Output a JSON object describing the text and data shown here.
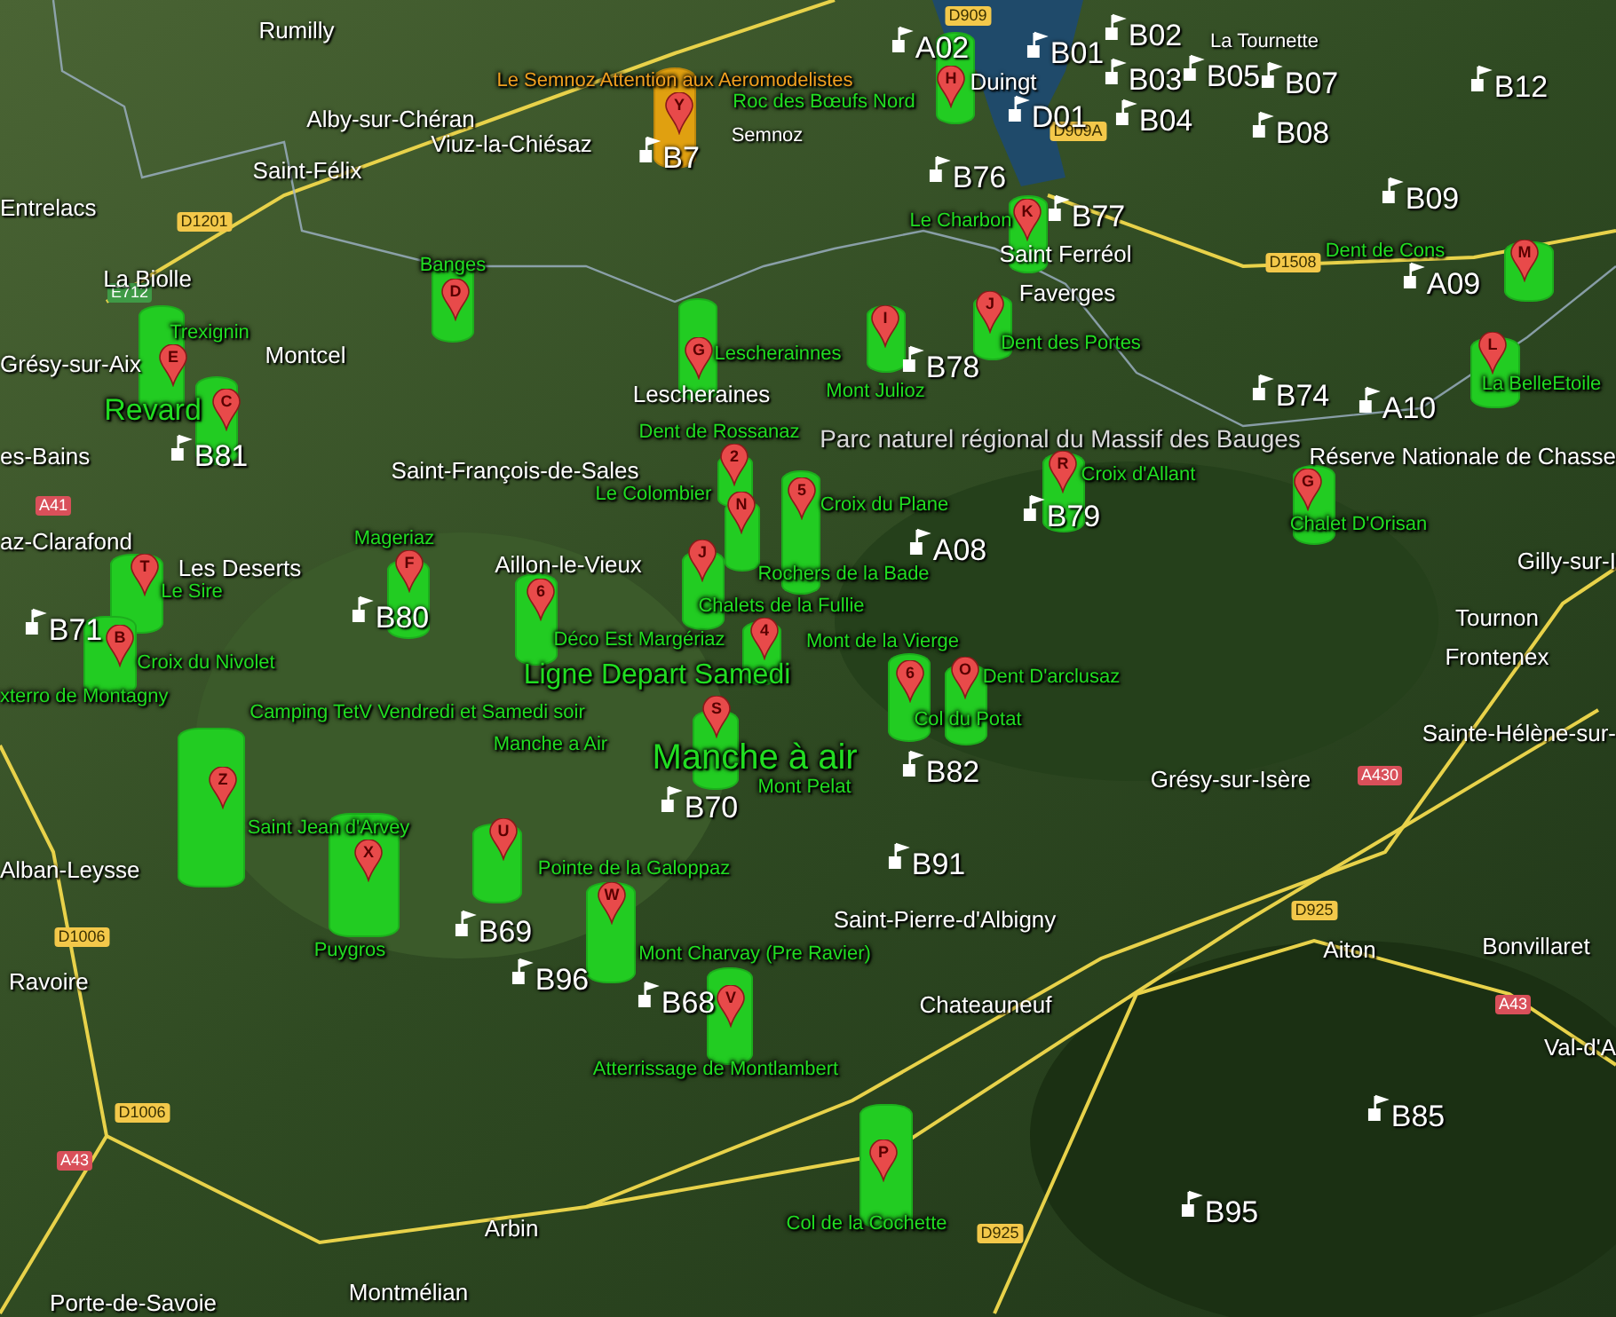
{
  "places": [
    {
      "name": "Rumilly"
    },
    {
      "name": "Alby-sur-Chéran"
    },
    {
      "name": "Viuz-la-Chiésaz"
    },
    {
      "name": "Semnoz"
    },
    {
      "name": "Saint-Félix"
    },
    {
      "name": "Entrelacs"
    },
    {
      "name": "La Biolle"
    },
    {
      "name": "Montcel"
    },
    {
      "name": "Grésy-sur-Aix"
    },
    {
      "name": "Lescheraines"
    },
    {
      "name": "Duingt"
    },
    {
      "name": "La Tournette"
    },
    {
      "name": "Saint Ferréol"
    },
    {
      "name": "Faverges"
    },
    {
      "name": "Parc naturel régional du Massif des Bauges"
    },
    {
      "name": "es-Bains"
    },
    {
      "name": "Saint-François-de-Sales"
    },
    {
      "name": "az-Clarafond"
    },
    {
      "name": "Les Deserts"
    },
    {
      "name": "Aillon-le-Vieux"
    },
    {
      "name": "Réserve Nationale de Chasse"
    },
    {
      "name": "Gilly-sur-I"
    },
    {
      "name": "Tournon"
    },
    {
      "name": "Frontenex"
    },
    {
      "name": "Sainte-Hélène-sur-"
    },
    {
      "name": "Grésy-sur-Isère"
    },
    {
      "name": "Saint-Pierre-d'Albigny"
    },
    {
      "name": "Chateauneuf"
    },
    {
      "name": "Aiton"
    },
    {
      "name": "Bonvillaret"
    },
    {
      "name": "Val-d'A"
    },
    {
      "name": "Alban-Leysse"
    },
    {
      "name": "Ravoire"
    },
    {
      "name": "Arbin"
    },
    {
      "name": "Montmélian"
    },
    {
      "name": "Porte-de-Savoie"
    }
  ],
  "waypoints": [
    {
      "code": "A02"
    },
    {
      "code": "B01"
    },
    {
      "code": "B02"
    },
    {
      "code": "B03"
    },
    {
      "code": "B05"
    },
    {
      "code": "B07"
    },
    {
      "code": "B12"
    },
    {
      "code": "D01"
    },
    {
      "code": "B04"
    },
    {
      "code": "B08"
    },
    {
      "code": "B76"
    },
    {
      "code": "B77"
    },
    {
      "code": "B09"
    },
    {
      "code": "A09"
    },
    {
      "code": "B78"
    },
    {
      "code": "B74"
    },
    {
      "code": "A10"
    },
    {
      "code": "B7"
    },
    {
      "code": "A08"
    },
    {
      "code": "B79"
    },
    {
      "code": "B82"
    },
    {
      "code": "B91"
    },
    {
      "code": "B81"
    },
    {
      "code": "B80"
    },
    {
      "code": "B71"
    },
    {
      "code": "B70"
    },
    {
      "code": "B69"
    },
    {
      "code": "B96"
    },
    {
      "code": "B68"
    },
    {
      "code": "B85"
    },
    {
      "code": "B95"
    }
  ],
  "sites": [
    {
      "name": "Le Semnoz Attention aux Aeromodelistes",
      "color": "#f0a020"
    },
    {
      "name": "Roc des Bœufs Nord",
      "color": "#22dd22"
    },
    {
      "name": "Le Charbon",
      "color": "#22dd22"
    },
    {
      "name": "Dent des Portes",
      "color": "#22dd22"
    },
    {
      "name": "Dent de Cons",
      "color": "#22dd22"
    },
    {
      "name": "La BelleEtoile",
      "color": "#22dd22"
    },
    {
      "name": "Mont Julioz",
      "color": "#22dd22"
    },
    {
      "name": "Banges",
      "color": "#22dd22"
    },
    {
      "name": "Lescherainnes",
      "color": "#22dd22"
    },
    {
      "name": "Trexignin",
      "color": "#22dd22"
    },
    {
      "name": "Revard",
      "color": "#22dd22"
    },
    {
      "name": "Dent de Rossanaz",
      "color": "#22dd22"
    },
    {
      "name": "Le Colombier",
      "color": "#22dd22"
    },
    {
      "name": "Croix du Plane",
      "color": "#22dd22"
    },
    {
      "name": "Rochers de la Bade",
      "color": "#22dd22"
    },
    {
      "name": "Chalets de la Fullie",
      "color": "#22dd22"
    },
    {
      "name": "Mont de la Vierge",
      "color": "#22dd22"
    },
    {
      "name": "Croix d'Allant",
      "color": "#22dd22"
    },
    {
      "name": "Chalet D'Orisan",
      "color": "#22dd22"
    },
    {
      "name": "Dent D'arclusaz",
      "color": "#22dd22"
    },
    {
      "name": "Col du Potat",
      "color": "#22dd22"
    },
    {
      "name": "Mageriaz",
      "color": "#22dd22"
    },
    {
      "name": "Le Sire",
      "color": "#22dd22"
    },
    {
      "name": "Croix du Nivolet",
      "color": "#22dd22"
    },
    {
      "name": "xterro de Montagny",
      "color": "#22dd22"
    },
    {
      "name": "Déco Est Margériaz",
      "color": "#22dd22"
    },
    {
      "name": "Ligne Depart Samedi",
      "color": "#22dd22"
    },
    {
      "name": "Camping TetV Vendredi et Samedi soir",
      "color": "#22dd22"
    },
    {
      "name": "Manche à air",
      "color": "#22dd22"
    },
    {
      "name": "Manche a Air",
      "color": "#22dd22"
    },
    {
      "name": "Mont Pelat",
      "color": "#22dd22"
    },
    {
      "name": "Saint Jean d'Arvey",
      "color": "#22dd22"
    },
    {
      "name": "Pointe de la Galoppaz",
      "color": "#22dd22"
    },
    {
      "name": "Puygros",
      "color": "#22dd22"
    },
    {
      "name": "Mont Charvay (Pre Ravier)",
      "color": "#22dd22"
    },
    {
      "name": "Atterrissage de Montlambert",
      "color": "#22dd22"
    },
    {
      "name": "Col de la Cochette",
      "color": "#22dd22"
    }
  ],
  "road_signs": [
    {
      "label": "D909",
      "kind": "departmental"
    },
    {
      "label": "D909A",
      "kind": "departmental"
    },
    {
      "label": "D1201",
      "kind": "departmental"
    },
    {
      "label": "E712",
      "kind": "european"
    },
    {
      "label": "D1508",
      "kind": "departmental"
    },
    {
      "label": "A41",
      "kind": "autoroute"
    },
    {
      "label": "A430",
      "kind": "autoroute"
    },
    {
      "label": "D925",
      "kind": "departmental"
    },
    {
      "label": "A43",
      "kind": "autoroute"
    },
    {
      "label": "D1006",
      "kind": "departmental"
    },
    {
      "label": "D1006",
      "kind": "departmental"
    },
    {
      "label": "A43",
      "kind": "autoroute"
    },
    {
      "label": "D925",
      "kind": "departmental"
    }
  ],
  "markers": [
    {
      "letter": "Y",
      "color": "#e0a010"
    },
    {
      "letter": "H",
      "color": "#22cc22"
    },
    {
      "letter": "K",
      "color": "#22cc22"
    },
    {
      "letter": "D",
      "color": "#22cc22"
    },
    {
      "letter": "E",
      "color": "#22cc22"
    },
    {
      "letter": "C",
      "color": "#22cc22"
    },
    {
      "letter": "G",
      "color": "#22cc22"
    },
    {
      "letter": "I",
      "color": "#22cc22"
    },
    {
      "letter": "J",
      "color": "#22cc22"
    },
    {
      "letter": "M",
      "color": "#22cc22"
    },
    {
      "letter": "L",
      "color": "#22cc22"
    },
    {
      "letter": "2",
      "color": "#22cc22"
    },
    {
      "letter": "N",
      "color": "#22cc22"
    },
    {
      "letter": "5",
      "color": "#22cc22"
    },
    {
      "letter": "J",
      "color": "#22cc22"
    },
    {
      "letter": "4",
      "color": "#22cc22"
    },
    {
      "letter": "6",
      "color": "#22cc22"
    },
    {
      "letter": "F",
      "color": "#22cc22"
    },
    {
      "letter": "T",
      "color": "#22cc22"
    },
    {
      "letter": "B",
      "color": "#22cc22"
    },
    {
      "letter": "Z",
      "color": "#22cc22"
    },
    {
      "letter": "X",
      "color": "#22cc22"
    },
    {
      "letter": "U",
      "color": "#22cc22"
    },
    {
      "letter": "S",
      "color": "#22cc22"
    },
    {
      "letter": "W",
      "color": "#22cc22"
    },
    {
      "letter": "V",
      "color": "#22cc22"
    },
    {
      "letter": "P",
      "color": "#22cc22"
    },
    {
      "letter": "6",
      "color": "#22cc22"
    },
    {
      "letter": "O",
      "color": "#22cc22"
    },
    {
      "letter": "R",
      "color": "#22cc22"
    },
    {
      "letter": "G",
      "color": "#22cc22"
    }
  ]
}
